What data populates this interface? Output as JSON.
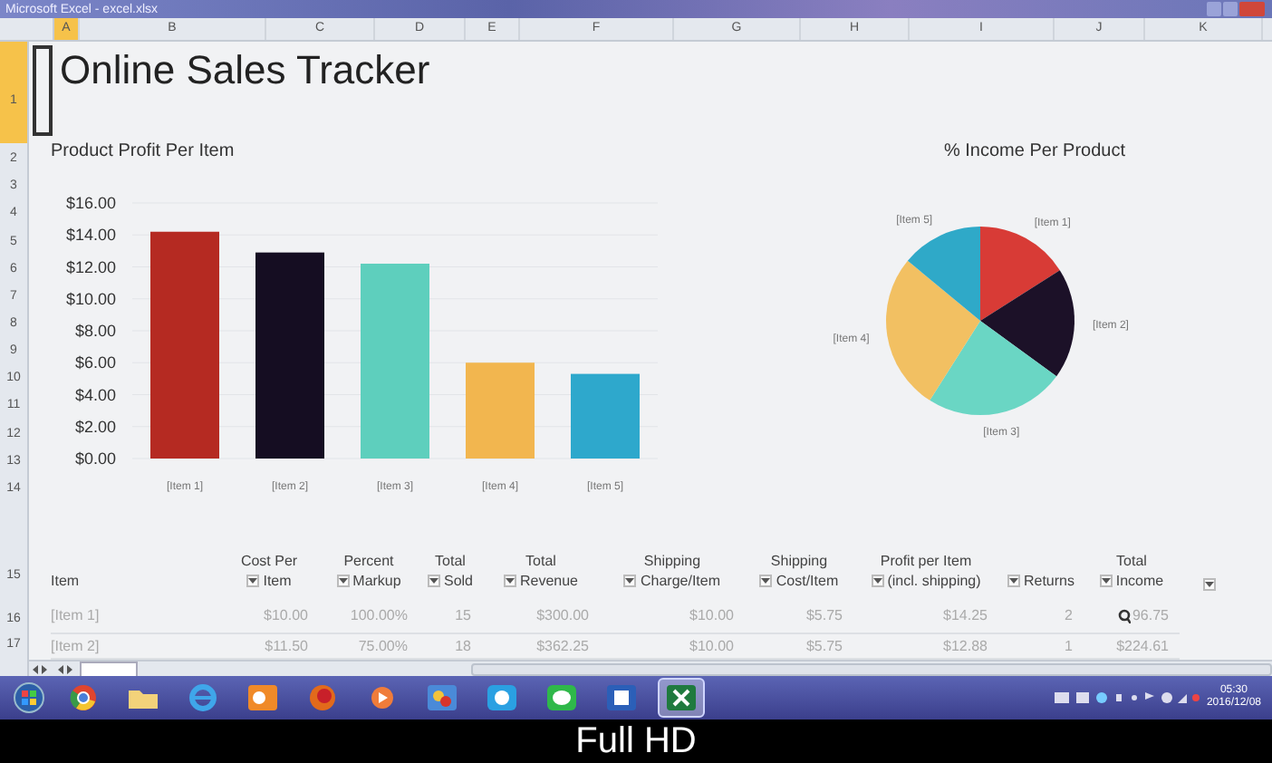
{
  "window": {
    "title": "Microsoft Excel - excel.xlsx"
  },
  "columns": [
    {
      "label": "A",
      "selected": true
    },
    {
      "label": "B",
      "selected": false
    },
    {
      "label": "C",
      "selected": false
    },
    {
      "label": "D",
      "selected": false
    },
    {
      "label": "E",
      "selected": false
    },
    {
      "label": "F",
      "selected": false
    },
    {
      "label": "G",
      "selected": false
    },
    {
      "label": "H",
      "selected": false
    },
    {
      "label": "I",
      "selected": false
    },
    {
      "label": "J",
      "selected": false
    },
    {
      "label": "K",
      "selected": false
    }
  ],
  "row_numbers": [
    {
      "label": "1",
      "selected": true
    },
    {
      "label": "2",
      "selected": false
    },
    {
      "label": "3",
      "selected": false
    },
    {
      "label": "4",
      "selected": false
    },
    {
      "label": "5",
      "selected": false
    },
    {
      "label": "6",
      "selected": false
    },
    {
      "label": "7",
      "selected": false
    },
    {
      "label": "8",
      "selected": false
    },
    {
      "label": "9",
      "selected": false
    },
    {
      "label": "10",
      "selected": false
    },
    {
      "label": "11",
      "selected": false
    },
    {
      "label": "12",
      "selected": false
    },
    {
      "label": "13",
      "selected": false
    },
    {
      "label": "14",
      "selected": false
    },
    {
      "label": "15",
      "selected": false
    },
    {
      "label": "16",
      "selected": false
    },
    {
      "label": "17",
      "selected": false
    }
  ],
  "sheet_title": "Online Sales Tracker",
  "bar_chart": {
    "chart_data": {
      "type": "bar",
      "title": "Product Profit Per Item",
      "categories": [
        "[Item 1]",
        "[Item 2]",
        "[Item 3]",
        "[Item 4]",
        "[Item 5]"
      ],
      "series": [
        {
          "color": "#b52a22",
          "values": [
            14.2,
            null,
            null,
            null,
            null
          ]
        },
        {
          "color": "#150d22",
          "values": [
            null,
            12.9,
            null,
            null,
            null
          ]
        },
        {
          "color": "#5ecfbd",
          "values": [
            null,
            null,
            12.2,
            null,
            null
          ]
        },
        {
          "color": "#f2b64f",
          "values": [
            null,
            null,
            null,
            6.0,
            null
          ]
        },
        {
          "color": "#2ea8cc",
          "values": [
            null,
            null,
            null,
            null,
            5.3
          ]
        }
      ],
      "stacked": true,
      "grid": true,
      "ylim": [
        0,
        16
      ],
      "yticks": [
        {
          "value": 0,
          "label": "$0.00"
        },
        {
          "value": 2,
          "label": "$2.00"
        },
        {
          "value": 4,
          "label": "$4.00"
        },
        {
          "value": 6,
          "label": "$6.00"
        },
        {
          "value": 8,
          "label": "$8.00"
        },
        {
          "value": 10,
          "label": "$10.00"
        },
        {
          "value": 12,
          "label": "$12.00"
        },
        {
          "value": 14,
          "label": "$14.00"
        },
        {
          "value": 16,
          "label": "$16.00"
        }
      ]
    }
  },
  "pie_chart": {
    "title": "% Income Per Product",
    "slices": [
      {
        "label": "[Item 1]",
        "color": "#d83b36"
      },
      {
        "label": "[Item 2]",
        "color": "#1c1128"
      },
      {
        "label": "[Item 3]",
        "color": "#6ad6c4"
      },
      {
        "label": "[Item 4]",
        "color": "#f2c062"
      },
      {
        "label": "[Item 5]",
        "color": "#2fa9c8"
      }
    ]
  },
  "table": {
    "columns": [
      {
        "bottom": "Item",
        "filter": false
      },
      {
        "top": "Cost Per",
        "bottom": "Item",
        "filter": true
      },
      {
        "top": "Percent",
        "bottom": "Markup",
        "filter": true
      },
      {
        "top": "Total",
        "bottom": "Sold",
        "filter": true
      },
      {
        "top": "Total",
        "bottom": "Revenue",
        "filter": true
      },
      {
        "top": "Shipping",
        "bottom": "Charge/Item",
        "filter": true
      },
      {
        "top": "Shipping",
        "bottom": "Cost/Item",
        "filter": true
      },
      {
        "top": "Profit per Item",
        "bottom": "(incl. shipping)",
        "filter": true
      },
      {
        "bottom": "Returns",
        "filter": true
      },
      {
        "top": "Total",
        "bottom": "Income",
        "filter": true
      },
      {
        "filter": true
      }
    ],
    "rows": [
      [
        "[Item 1]",
        "$10.00",
        "100.00%",
        "15",
        "$300.00",
        "$10.00",
        "$5.75",
        "$14.25",
        "2",
        "96.75"
      ],
      [
        "[Item 2]",
        "$11.50",
        "75.00%",
        "18",
        "$362.25",
        "$10.00",
        "$5.75",
        "$12.88",
        "1",
        "$224.61"
      ]
    ]
  },
  "taskbar": {
    "apps": [
      {
        "kind": "browser",
        "selected": false
      },
      {
        "kind": "folder",
        "selected": false
      },
      {
        "kind": "globe",
        "selected": false
      },
      {
        "kind": "mail",
        "selected": false
      },
      {
        "kind": "fox",
        "selected": false
      },
      {
        "kind": "player",
        "selected": false
      },
      {
        "kind": "paint",
        "selected": false
      },
      {
        "kind": "chat",
        "selected": false
      },
      {
        "kind": "bubble",
        "selected": false
      },
      {
        "kind": "doc",
        "selected": false
      },
      {
        "kind": "sheet",
        "selected": true
      }
    ],
    "clock": {
      "time": "05:30",
      "date": "2016/12/08"
    }
  },
  "caption": "Full HD"
}
